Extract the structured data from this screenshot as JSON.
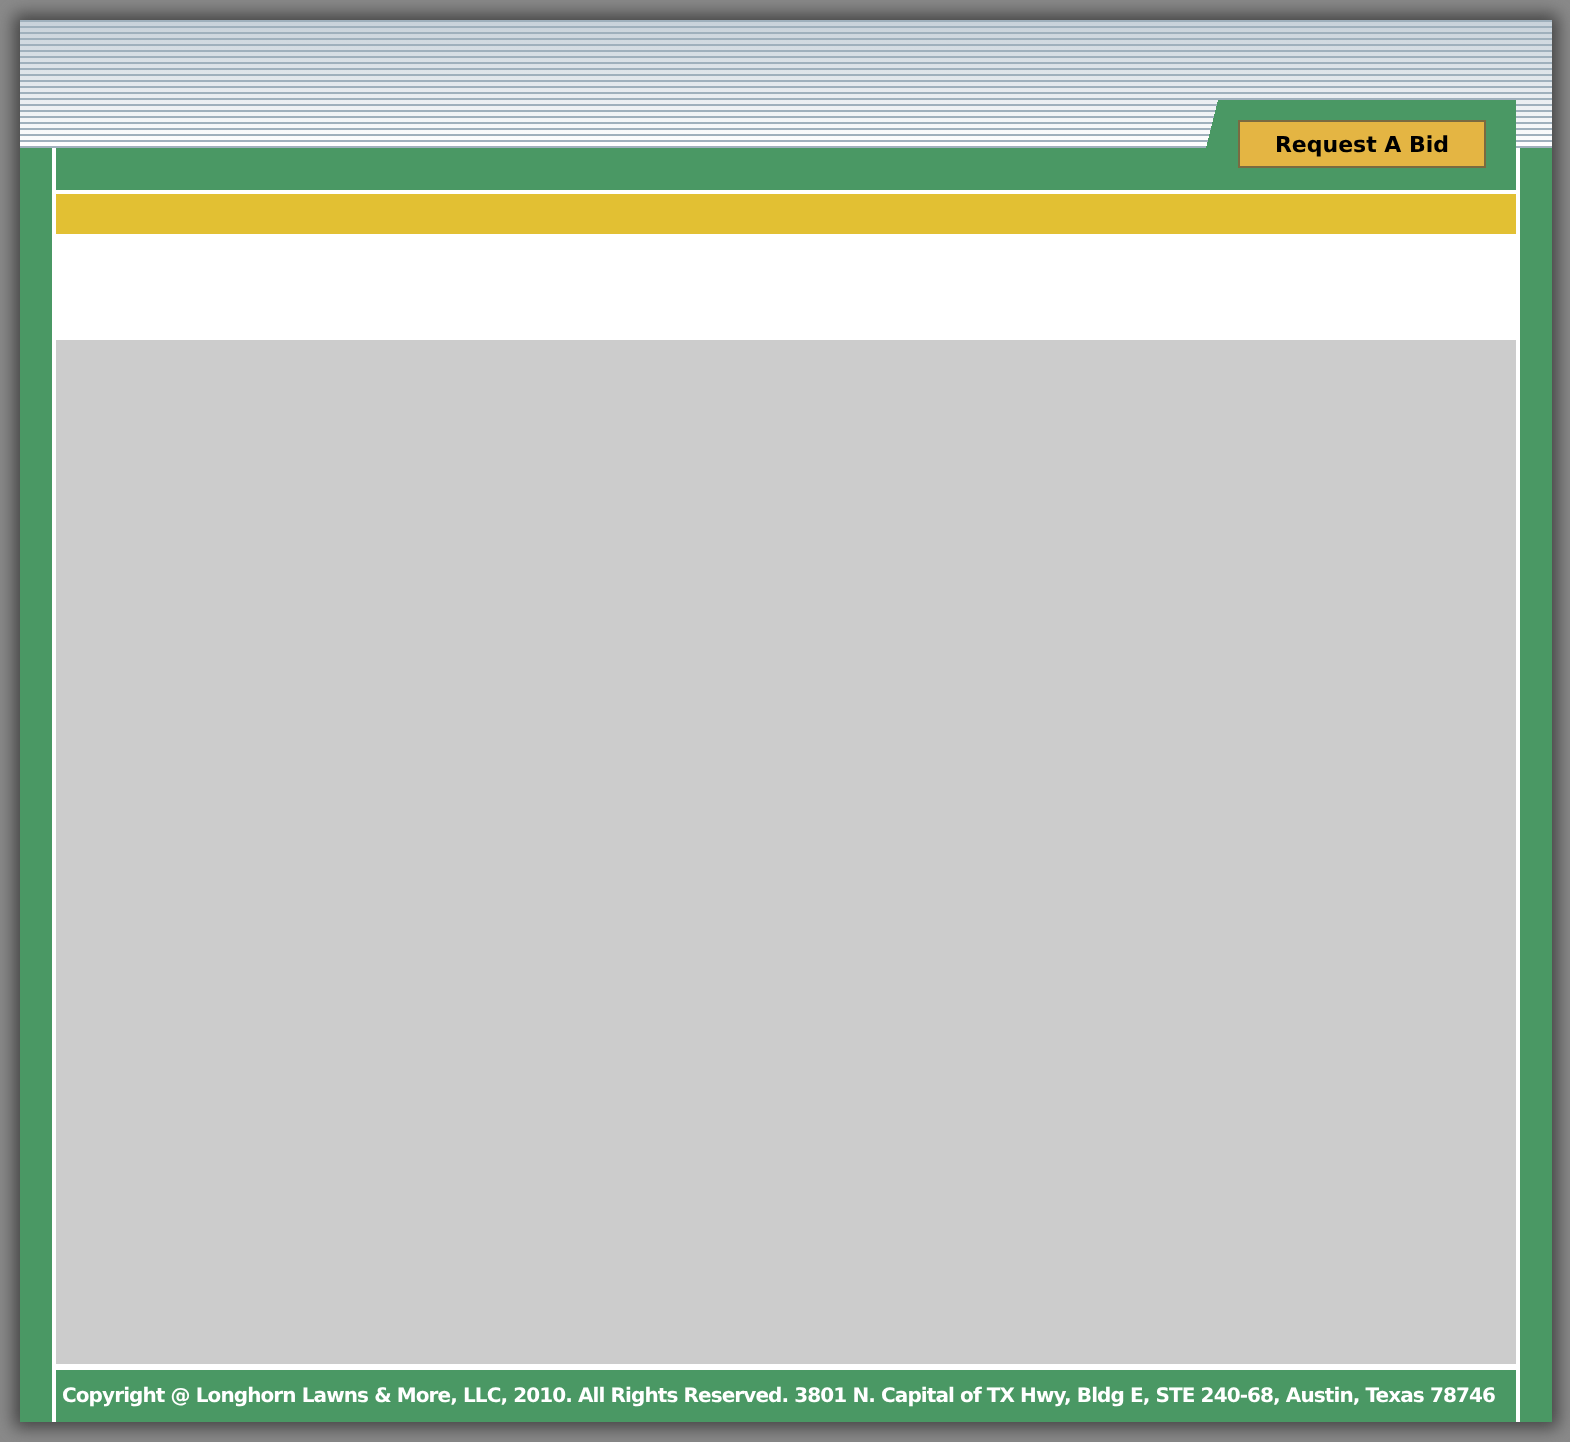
{
  "header": {
    "button": "Request A Bid"
  },
  "footer": {
    "text": "Copyright @ Longhorn Lawns & More, LLC, 2010. All Rights Reserved. 3801 N. Capital of TX Hwy, Bldg E, STE 240-68, Austin, Texas 78746"
  }
}
